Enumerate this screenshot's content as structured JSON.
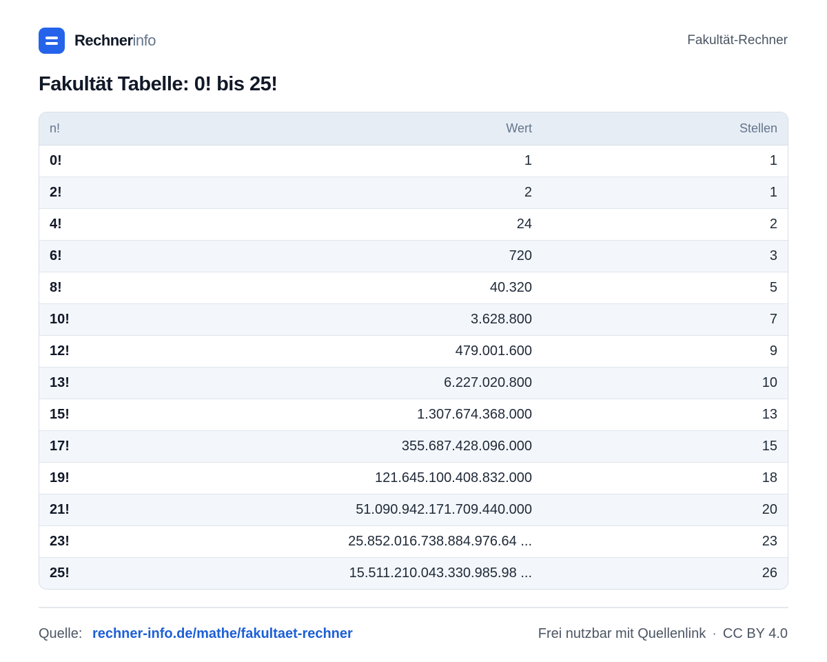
{
  "brand": {
    "strong": "Rechner",
    "light": "info"
  },
  "header": {
    "page_label": "Fakultät-Rechner"
  },
  "title": "Fakultät Tabelle: 0! bis 25!",
  "table": {
    "columns": [
      "n!",
      "Wert",
      "Stellen"
    ],
    "rows": [
      {
        "n": "0!",
        "value": "1",
        "digits": "1"
      },
      {
        "n": "2!",
        "value": "2",
        "digits": "1"
      },
      {
        "n": "4!",
        "value": "24",
        "digits": "2"
      },
      {
        "n": "6!",
        "value": "720",
        "digits": "3"
      },
      {
        "n": "8!",
        "value": "40.320",
        "digits": "5"
      },
      {
        "n": "10!",
        "value": "3.628.800",
        "digits": "7"
      },
      {
        "n": "12!",
        "value": "479.001.600",
        "digits": "9"
      },
      {
        "n": "13!",
        "value": "6.227.020.800",
        "digits": "10"
      },
      {
        "n": "15!",
        "value": "1.307.674.368.000",
        "digits": "13"
      },
      {
        "n": "17!",
        "value": "355.687.428.096.000",
        "digits": "15"
      },
      {
        "n": "19!",
        "value": "121.645.100.408.832.000",
        "digits": "18"
      },
      {
        "n": "21!",
        "value": "51.090.942.171.709.440.000",
        "digits": "20"
      },
      {
        "n": "23!",
        "value": "25.852.016.738.884.976.64 ...",
        "digits": "23"
      },
      {
        "n": "25!",
        "value": "15.511.210.043.330.985.98 ...",
        "digits": "26"
      }
    ]
  },
  "footer": {
    "source_label": "Quelle:",
    "source_link": "rechner-info.de/mathe/fakultaet-rechner",
    "usage": "Frei nutzbar mit Quellenlink",
    "separator": "·",
    "license": "CC BY 4.0"
  },
  "colors": {
    "accent": "#2563eb",
    "link": "#1d5fd6",
    "header_bg": "#e6edf5",
    "stripe": "#f3f7fb"
  }
}
